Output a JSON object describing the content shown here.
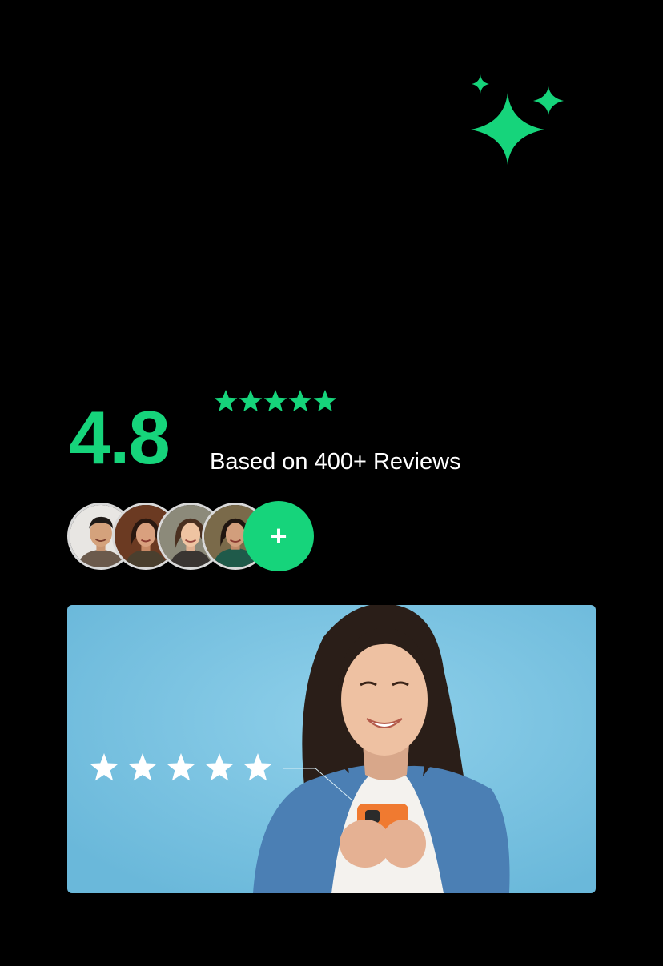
{
  "colors": {
    "accent": "#16d47b",
    "background": "#000000",
    "text": "#ffffff",
    "hero_bg": "#7cc6e4"
  },
  "decoration": {
    "icon": "sparkles-icon"
  },
  "rating": {
    "score": "4.8",
    "stars": 5,
    "caption": "Based on 400+ Reviews"
  },
  "reviewers": {
    "avatars": [
      "reviewer-avatar",
      "reviewer-avatar",
      "reviewer-avatar",
      "reviewer-avatar"
    ],
    "add_label": "+"
  },
  "hero": {
    "stars": 5,
    "icon": "star-icon"
  }
}
